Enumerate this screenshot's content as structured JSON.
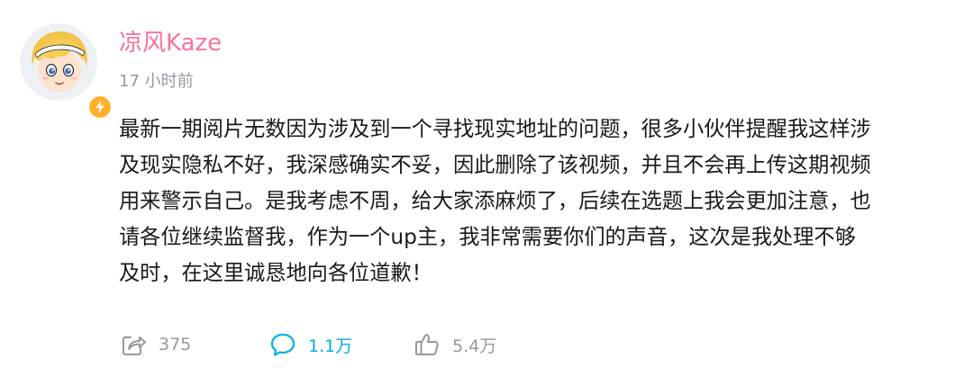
{
  "user": {
    "name": "凉风Kaze",
    "time": "17 小时前",
    "avatar_icon": "cartoon-boy-avatar",
    "badge_icon": "lightning-badge-icon"
  },
  "post": {
    "lines": [
      "最新一期阅片无数因为涉及到一个寻找现实地址的问题，很多小伙伴提醒我这样涉",
      "及现实隐私不好，我深感确实不妥，因此删除了该视频，并且不会再上传这期视频",
      "用来警示自己。是我考虑不周，给大家添麻烦了，后续在选题上我会更加注意，也",
      "请各位继续监督我，作为一个up主，我非常需要你们的声音，这次是我处理不够",
      "及时，在这里诚恳地向各位道歉！"
    ]
  },
  "actions": {
    "share": {
      "icon": "share-icon",
      "count": "375"
    },
    "comment": {
      "icon": "comment-icon",
      "count": "1.1万"
    },
    "like": {
      "icon": "thumbs-up-icon",
      "count": "5.4万"
    }
  },
  "colors": {
    "username": "#fb7299",
    "muted": "#9499a0",
    "accent": "#00aeec",
    "text": "#18191c",
    "badge": "#ffb027"
  }
}
